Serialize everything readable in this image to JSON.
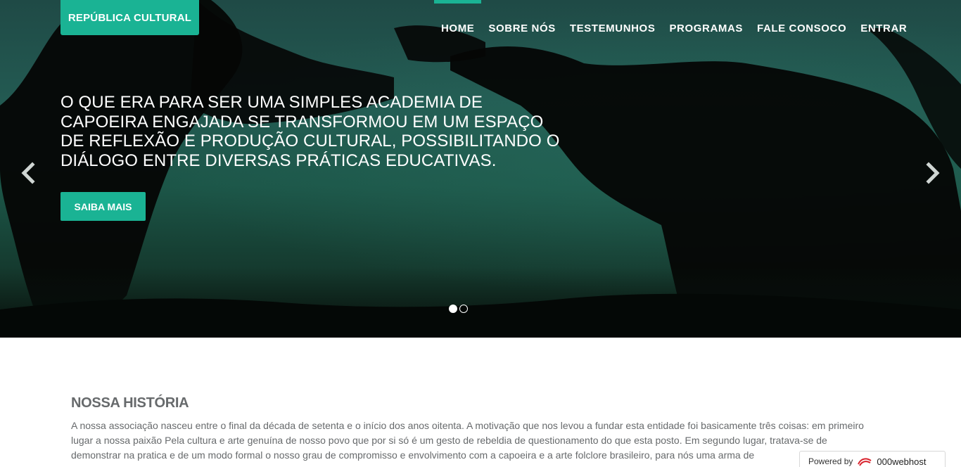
{
  "brand": {
    "label": "REPÚBLICA CULTURAL"
  },
  "nav": {
    "items": [
      {
        "label": "HOME"
      },
      {
        "label": "SOBRE NÓS"
      },
      {
        "label": "TESTEMUNHOS"
      },
      {
        "label": "PROGRAMAS"
      },
      {
        "label": "FALE CONSOCO"
      },
      {
        "label": "ENTRAR"
      }
    ],
    "active_index": 0
  },
  "hero": {
    "headline": "O que era para ser uma simples academia de capoeira engajada se transformou em um espaço de reflexão e produção cultural, possibilitando o diálogo entre diversas práticas educativas.",
    "cta_label": "SAIBA MAIS",
    "slides_count": 2,
    "active_slide": 1
  },
  "history": {
    "title": "NOSSA HISTÓRIA",
    "text": "A nossa associação nasceu entre o final da década de setenta e o início dos anos oitenta. A motivação que nos levou a fundar esta entidade foi basicamente três coisas: em primeiro lugar a nossa paixão Pela cultura e arte genuína de nosso povo que por si só é um gesto de rebeldia de questionamento do que esta posto. Em segundo lugar, tratava-se de demonstrar na pratica e de um modo formal o nosso grau de compromisso e envolvimento com a capoeira e a arte folclore brasileiro, para nós uma arma de"
  },
  "badge": {
    "prefix": "Powered by",
    "logo_text": "000webhost"
  },
  "colors": {
    "accent": "#1ab394",
    "text": "#676a6c"
  },
  "icons": {
    "prev": "chevron-left-icon",
    "next": "chevron-right-icon"
  }
}
